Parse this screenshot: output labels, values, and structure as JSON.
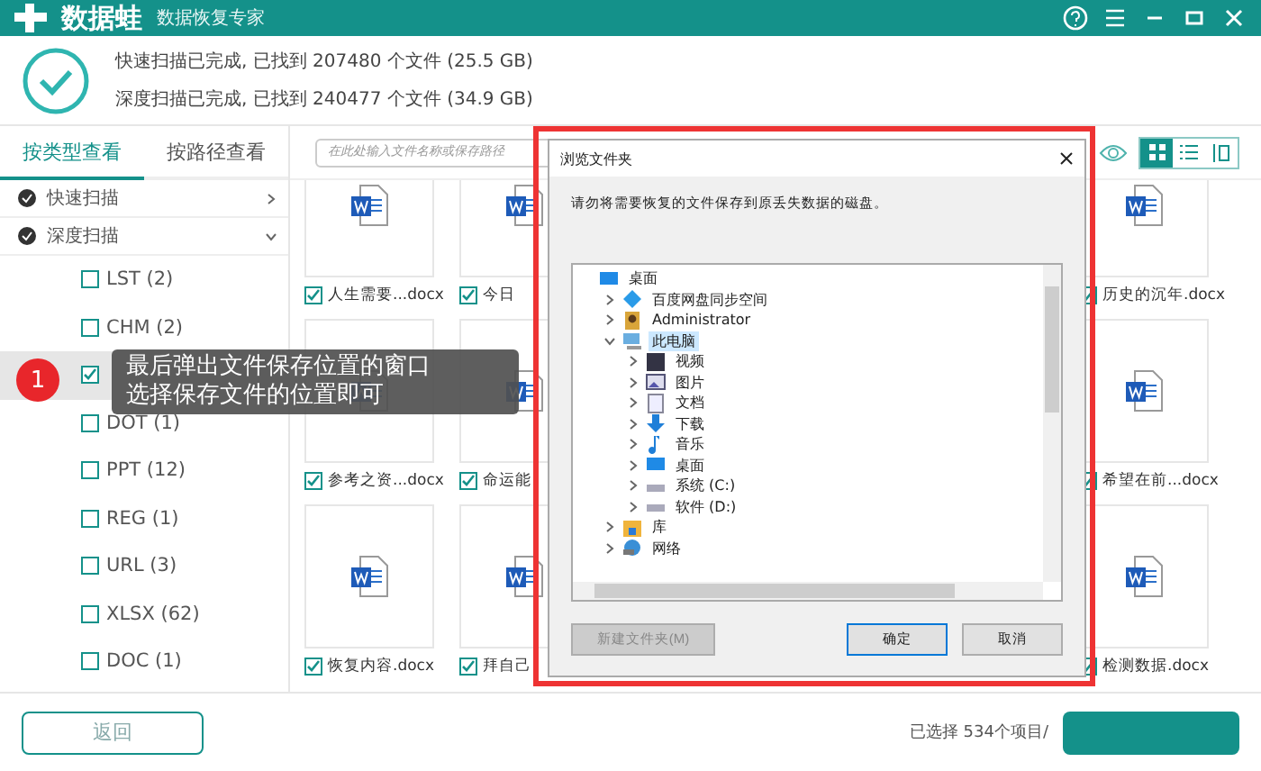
{
  "header": {
    "logo": "数据蛙",
    "subtitle": "数据恢复专家"
  },
  "summary": {
    "lines": [
      "快速扫描已完成, 已找到 207480 个文件 (25.5 GB)",
      "深度扫描已完成, 已找到 240477 个文件 (34.9 GB)"
    ]
  },
  "tabs": [
    {
      "label": "按类型查看",
      "selected": true
    },
    {
      "label": "按路径查看",
      "selected": false
    }
  ],
  "sidebar": {
    "items": [
      {
        "label": "快速扫描",
        "checked": true,
        "expanded": false
      },
      {
        "label": "深度扫描",
        "checked": true,
        "expanded": true,
        "children": [
          {
            "label": "LST (2)",
            "checked": false,
            "selected": false
          },
          {
            "label": "CHM (2)",
            "checked": false,
            "selected": false
          },
          {
            "checked": true,
            "selected": true
          },
          {
            "label": "DOT (1)",
            "checked": false,
            "selected": false
          },
          {
            "label": "PPT (12)",
            "checked": false,
            "selected": false
          },
          {
            "label": "REG (1)",
            "checked": false,
            "selected": false
          },
          {
            "label": "URL (3)",
            "checked": false,
            "selected": false
          },
          {
            "label": "XLSX (62)",
            "checked": false,
            "selected": false
          },
          {
            "label": "DOC (1)",
            "checked": false,
            "selected": false
          }
        ]
      }
    ]
  },
  "search": {
    "placeholder": "在此处输入文件名称或保存路径"
  },
  "views": [
    {
      "kind": "grid",
      "selected": true
    },
    {
      "kind": "list",
      "selected": false
    },
    {
      "kind": "columns",
      "selected": false
    }
  ],
  "files": [
    {
      "name": "人生需要...docx",
      "checked": true
    },
    {
      "name": "今日",
      "checked": true
    },
    {
      "name": "历史的沉年.docx",
      "checked": true
    },
    {
      "name": "参考之资...docx",
      "checked": true
    },
    {
      "name": "命运能",
      "checked": true
    },
    {
      "name": "希望在前...docx",
      "checked": true
    },
    {
      "name": "恢复内容.docx",
      "checked": true
    },
    {
      "name": "拜自己",
      "checked": true
    },
    {
      "name": "检测数据.docx",
      "checked": true
    }
  ],
  "footer": {
    "back": "返回",
    "status": "已选择 534个项目/"
  },
  "dialog": {
    "title": "浏览文件夹",
    "message": "请勿将需要恢复的文件保存到原丢失数据的磁盘。",
    "tree": [
      {
        "label": "桌面",
        "kind": "desktop",
        "selected": false,
        "children": [
          {
            "label": "百度网盘同步空间",
            "kind": "cloud",
            "expanded": false,
            "selected": false
          },
          {
            "label": "Administrator",
            "kind": "user",
            "expanded": false,
            "selected": false
          },
          {
            "label": "此电脑",
            "kind": "pc",
            "expanded": true,
            "selected": true,
            "children": [
              {
                "label": "视频",
                "kind": "video",
                "expanded": false,
                "selected": false
              },
              {
                "label": "图片",
                "kind": "picture",
                "expanded": false,
                "selected": false
              },
              {
                "label": "文档",
                "kind": "document",
                "expanded": false,
                "selected": false
              },
              {
                "label": "下载",
                "kind": "download",
                "expanded": false,
                "selected": false
              },
              {
                "label": "音乐",
                "kind": "music",
                "expanded": false,
                "selected": false
              },
              {
                "label": "桌面",
                "kind": "desktop",
                "expanded": false,
                "selected": false
              },
              {
                "label": "系统 (C:)",
                "kind": "drive",
                "expanded": false,
                "selected": false
              },
              {
                "label": "软件 (D:)",
                "kind": "drive",
                "expanded": false,
                "selected": false
              }
            ]
          },
          {
            "label": "库",
            "kind": "library",
            "expanded": false,
            "selected": false
          },
          {
            "label": "网络",
            "kind": "network",
            "expanded": false,
            "selected": false
          }
        ]
      }
    ],
    "buttons": [
      {
        "label": "新建文件夹(M)",
        "disabled": true,
        "default": false
      },
      {
        "label": "确定",
        "disabled": false,
        "default": true
      },
      {
        "label": "取消",
        "disabled": false,
        "default": false
      }
    ]
  },
  "tooltip": {
    "badge": "1",
    "lines": [
      "最后弹出文件保存位置的窗口",
      "选择保存文件的位置即可"
    ]
  }
}
